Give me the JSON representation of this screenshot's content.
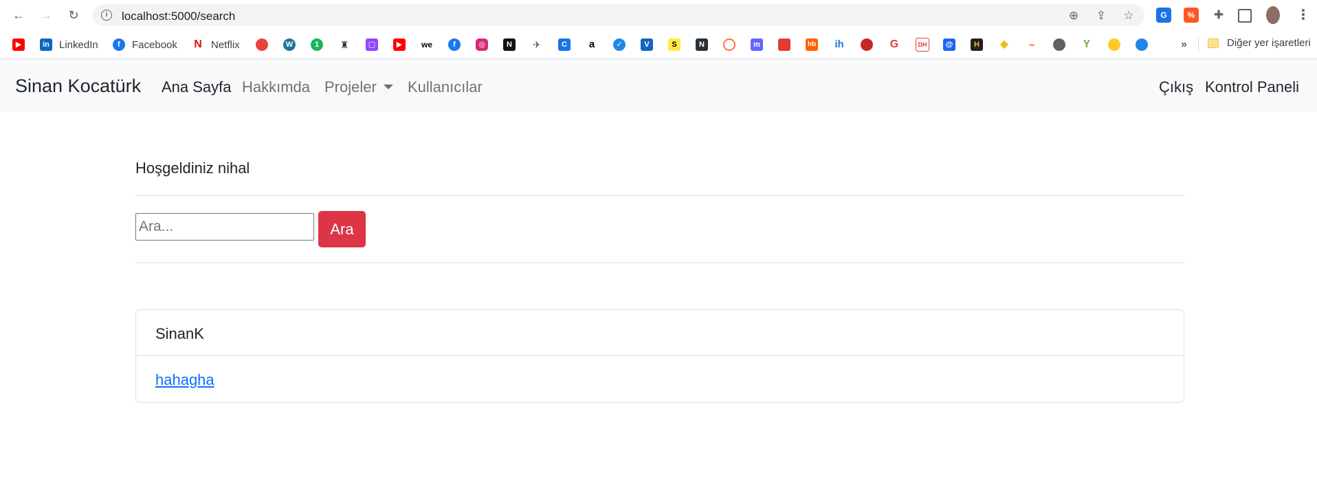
{
  "browser": {
    "url": "localhost:5000/search",
    "bookmarks": [
      {
        "label": "",
        "icon": "youtube-icon",
        "color": "#ff0000"
      },
      {
        "label": "LinkedIn",
        "icon": "linkedin-icon",
        "color": "#0a66c2"
      },
      {
        "label": "Facebook",
        "icon": "facebook-icon",
        "color": "#1877f2"
      },
      {
        "label": "Netflix",
        "icon": "netflix-icon",
        "color": "#e50914"
      }
    ],
    "other_bookmarks": "Diğer yer işaretleri",
    "more_bookmarks": "»"
  },
  "navbar": {
    "brand": "Sinan Kocatürk",
    "links": [
      "Ana Sayfa",
      "Hakkımda",
      "Projeler",
      "Kullanıcılar"
    ],
    "right_links": [
      "Çıkış",
      "Kontrol Paneli"
    ]
  },
  "main": {
    "welcome": "Hoşgeldiniz nihal",
    "search": {
      "placeholder": "Ara...",
      "value": "",
      "button": "Ara"
    },
    "result": {
      "header": "SinanK",
      "link": "hahagha"
    }
  },
  "colors": {
    "accent": "#dc3545",
    "link": "#0d6efd",
    "navbar_bg": "#f8f9fa"
  }
}
